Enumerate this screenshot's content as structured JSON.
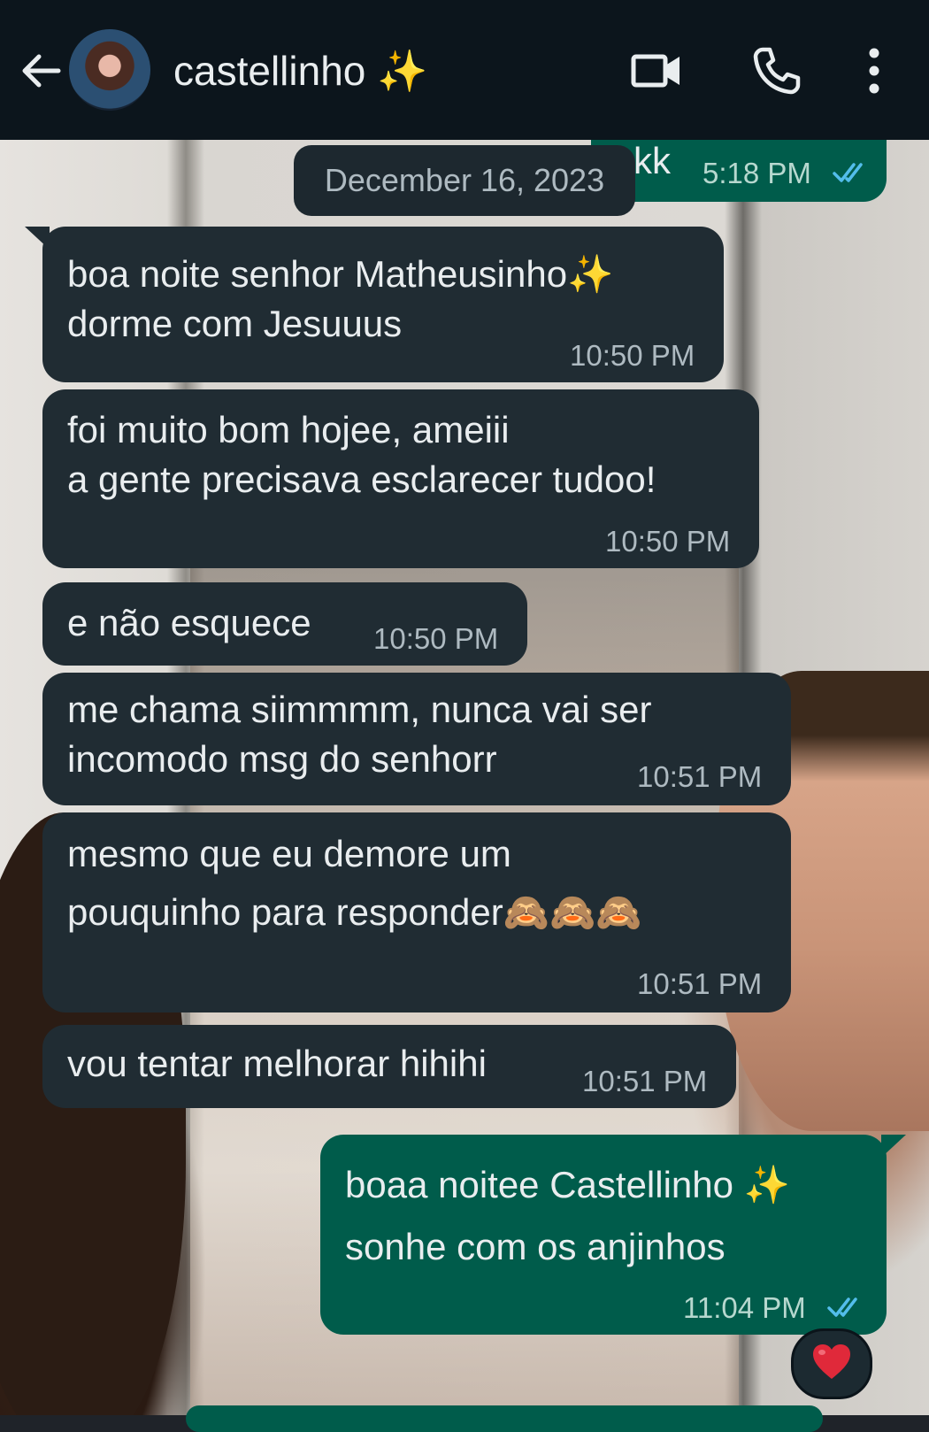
{
  "header": {
    "contact_name": "castellinho ✨"
  },
  "date_divider": "December 16, 2023",
  "messages": [
    {
      "direction": "out",
      "text": "kk",
      "time": "5:18 PM",
      "status": "read"
    },
    {
      "direction": "in",
      "text": "boa noite senhor Matheusinho✨\ndorme com Jesuuus",
      "time": "10:50 PM"
    },
    {
      "direction": "in",
      "text": "foi muito bom hojee, ameiii\na gente precisava esclarecer tudoo!",
      "time": "10:50 PM"
    },
    {
      "direction": "in",
      "text": "e não esquece",
      "time": "10:50 PM"
    },
    {
      "direction": "in",
      "text": "me chama siimmmm, nunca vai ser\nincomodo msg do senhorr",
      "time": "10:51 PM"
    },
    {
      "direction": "in",
      "text": "mesmo que eu demore um\npouquinho para responder🙈🙈🙈",
      "time": "10:51 PM"
    },
    {
      "direction": "in",
      "text": "vou tentar melhorar hihihi",
      "time": "10:51 PM"
    },
    {
      "direction": "out",
      "text": "boaa noitee Castellinho ✨\nsonhe com os anjinhos",
      "time": "11:04 PM",
      "status": "read",
      "reaction": "❤️"
    }
  ],
  "icons": {
    "back": "arrow-left-icon",
    "video": "video-camera-icon",
    "call": "phone-icon",
    "menu": "kebab-menu-icon",
    "read_receipt": "double-check-icon",
    "reaction": "red-heart-icon"
  },
  "colors": {
    "header_bg": "#0c151c",
    "incoming_bubble": "#202c33",
    "outgoing_bubble": "#005c4b",
    "read_ticks": "#53bdeb",
    "text": "#e9edef",
    "meta_text": "#aebac1"
  }
}
